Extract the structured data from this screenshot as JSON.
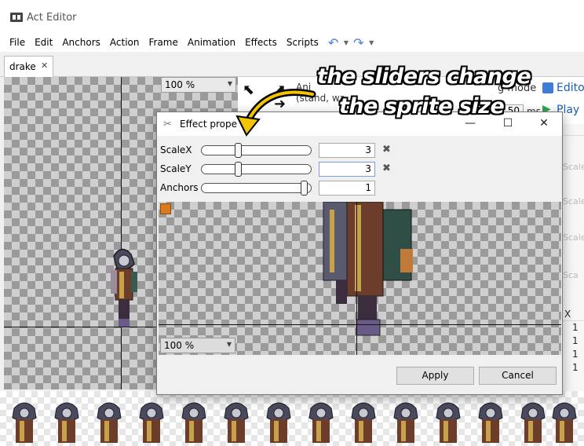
{
  "app": {
    "title": "Act Editor"
  },
  "menu": {
    "items": [
      "File",
      "Edit",
      "Anchors",
      "Action",
      "Frame",
      "Animation",
      "Effects",
      "Scripts"
    ]
  },
  "tabs": [
    {
      "label": "drake",
      "close": "✕"
    }
  ],
  "main_canvas": {
    "zoom": "100 %"
  },
  "right_panel": {
    "action_label": "Ani",
    "action_value": "(stand, wa",
    "mode_text": "g mode",
    "edit_label": "Edito",
    "delay_prefix": "ad",
    "delay_value": "50",
    "delay_unit": "ms",
    "play_label": "Play",
    "grid_placeholder": "Scale",
    "grid_placeholder_short": "Sca",
    "col_header": "X",
    "col_values": [
      "1",
      "1",
      "1",
      "1"
    ]
  },
  "dialog": {
    "title": "Effect prope",
    "minimize": "—",
    "maximize": "☐",
    "close": "✕",
    "properties": [
      {
        "label": "ScaleX",
        "value": "3",
        "slider": 0.32
      },
      {
        "label": "ScaleY",
        "value": "3",
        "slider": 0.32
      },
      {
        "label": "Anchors",
        "value": "1",
        "slider": 0.97
      }
    ],
    "preview_zoom": "100 %",
    "apply": "Apply",
    "cancel": "Cancel"
  },
  "annotation": {
    "line1": "the sliders change",
    "line2": "the sprite size"
  },
  "colors": {
    "accent": "#3b7dd8",
    "play": "#2fa84f",
    "swatch": "#d97a1f"
  }
}
